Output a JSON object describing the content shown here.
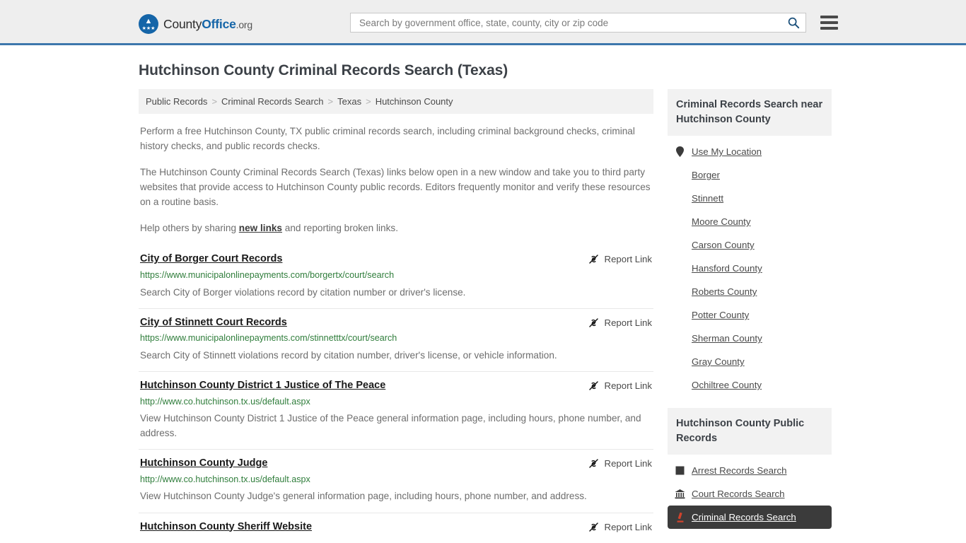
{
  "header": {
    "logo": {
      "text_1": "County",
      "text_2": "Office",
      "text_3": ".org",
      "icon": "eagle-seal-icon"
    },
    "search": {
      "placeholder": "Search by government office, state, county, city or zip code",
      "value": "",
      "icon": "search-icon"
    },
    "menu": {
      "icon": "hamburger-menu-icon",
      "label": "Menu"
    },
    "accent_color": "#3d77ac"
  },
  "page_title": "Hutchinson County Criminal Records Search (Texas)",
  "breadcrumb": {
    "items": [
      {
        "label": "Public Records"
      },
      {
        "label": "Criminal Records Search"
      },
      {
        "label": "Texas"
      },
      {
        "label": "Hutchinson County"
      }
    ],
    "separator": ">"
  },
  "intro": {
    "p1": "Perform a free Hutchinson County, TX public criminal records search, including criminal background checks, criminal history checks, and public records checks.",
    "p2": "The Hutchinson County Criminal Records Search (Texas) links below open in a new window and take you to third party websites that provide access to Hutchinson County public records. Editors frequently monitor and verify these resources on a routine basis.",
    "p3_before": "Help others by sharing ",
    "p3_link": "new links",
    "p3_after": " and reporting broken links."
  },
  "report_link_label": "Report Link",
  "report_link_icon": "broken-link-icon",
  "results": [
    {
      "title": "City of Borger Court Records",
      "url": "https://www.municipalonlinepayments.com/borgertx/court/search",
      "description": "Search City of Borger violations record by citation number or driver's license."
    },
    {
      "title": "City of Stinnett Court Records",
      "url": "https://www.municipalonlinepayments.com/stinnetttx/court/search",
      "description": "Search City of Stinnett violations record by citation number, driver's license, or vehicle information."
    },
    {
      "title": "Hutchinson County District 1 Justice of The Peace",
      "url": "http://www.co.hutchinson.tx.us/default.aspx",
      "description": "View Hutchinson County District 1 Justice of the Peace general information page, including hours, phone number, and address."
    },
    {
      "title": "Hutchinson County Judge",
      "url": "http://www.co.hutchinson.tx.us/default.aspx",
      "description": "View Hutchinson County Judge's general information page, including hours, phone number, and address."
    },
    {
      "title": "Hutchinson County Sheriff Website",
      "url": "",
      "description": ""
    }
  ],
  "sidebar": {
    "nearby": {
      "heading": "Criminal Records Search near Hutchinson County",
      "items": [
        {
          "label": "Use My Location",
          "icon": "map-pin-icon",
          "active": false
        },
        {
          "label": "Borger",
          "icon": "",
          "active": false
        },
        {
          "label": "Stinnett",
          "icon": "",
          "active": false
        },
        {
          "label": "Moore County",
          "icon": "",
          "active": false
        },
        {
          "label": "Carson County",
          "icon": "",
          "active": false
        },
        {
          "label": "Hansford County",
          "icon": "",
          "active": false
        },
        {
          "label": "Roberts County",
          "icon": "",
          "active": false
        },
        {
          "label": "Potter County",
          "icon": "",
          "active": false
        },
        {
          "label": "Sherman County",
          "icon": "",
          "active": false
        },
        {
          "label": "Gray County",
          "icon": "",
          "active": false
        },
        {
          "label": "Ochiltree County",
          "icon": "",
          "active": false
        }
      ]
    },
    "public_records": {
      "heading": "Hutchinson County Public Records",
      "items": [
        {
          "label": "Arrest Records Search",
          "icon": "fingerprint-card-icon",
          "active": false
        },
        {
          "label": "Court Records Search",
          "icon": "courthouse-icon",
          "active": false
        },
        {
          "label": "Criminal Records Search",
          "icon": "gavel-icon",
          "active": true
        }
      ]
    }
  }
}
